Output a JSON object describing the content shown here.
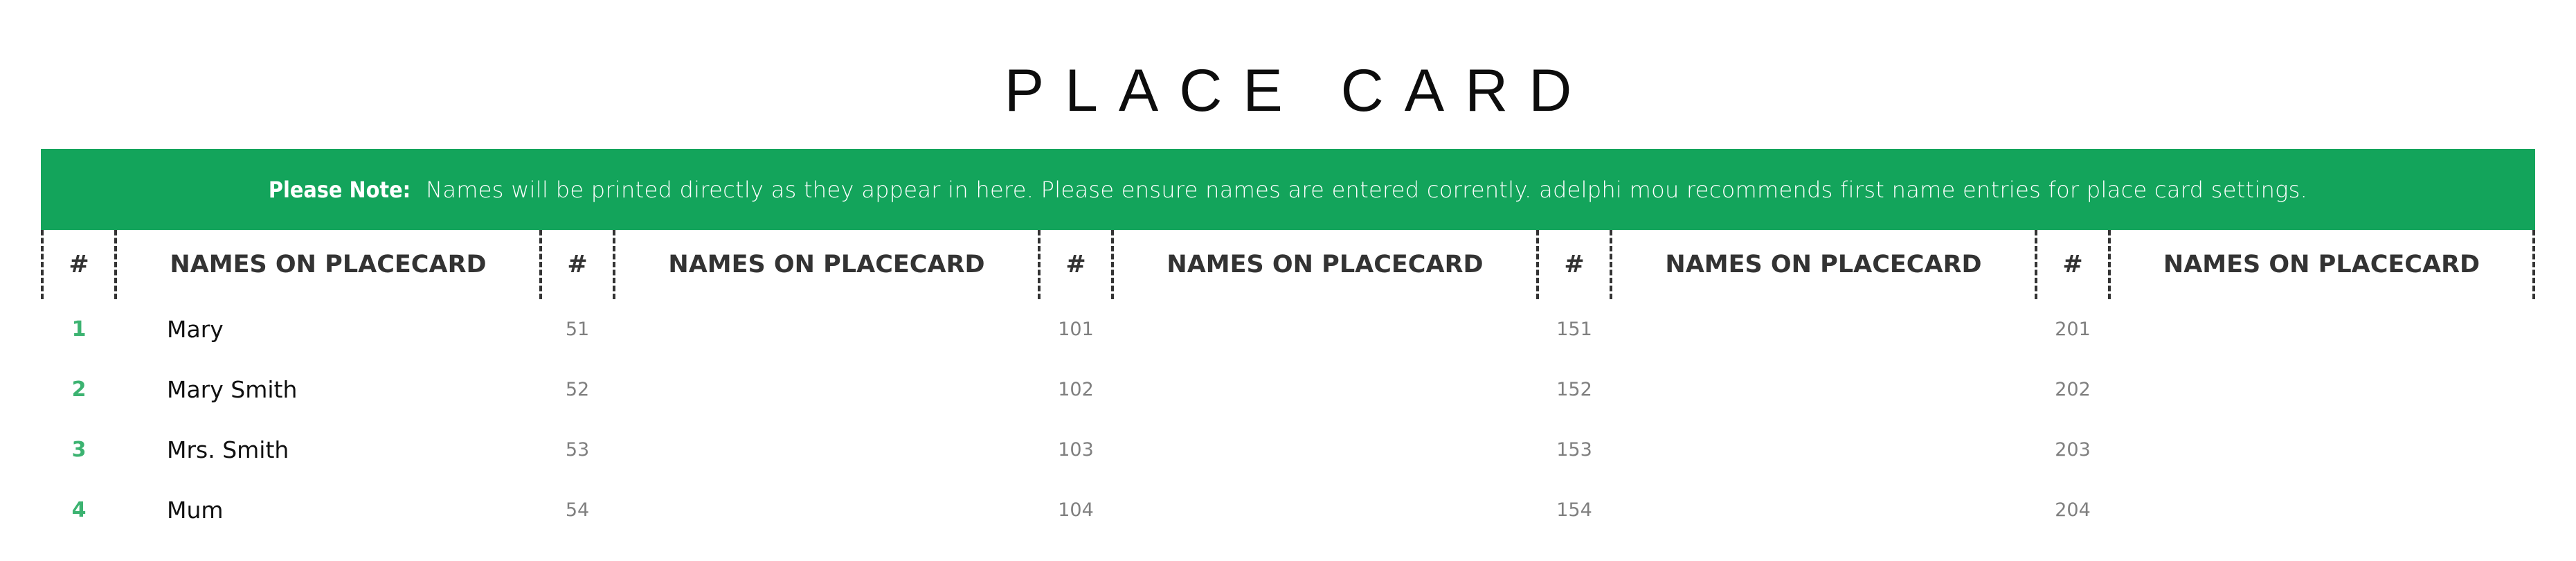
{
  "title": "PLACE CARD",
  "banner": {
    "label": "Please Note:",
    "text": "Names will be printed directly as they appear in here. Please ensure names are entered corrently. adelphi mou recommends first name entries for place card settings.",
    "color": "#13a45b"
  },
  "table": {
    "num_header": "#",
    "name_header": "NAMES ON PLACECARD",
    "groups": [
      {
        "rows": [
          {
            "num": "1",
            "name": "Mary"
          },
          {
            "num": "2",
            "name": "Mary Smith"
          },
          {
            "num": "3",
            "name": "Mrs. Smith"
          },
          {
            "num": "4",
            "name": "Mum"
          }
        ]
      },
      {
        "rows": [
          {
            "num": "51",
            "name": ""
          },
          {
            "num": "52",
            "name": ""
          },
          {
            "num": "53",
            "name": ""
          },
          {
            "num": "54",
            "name": ""
          }
        ]
      },
      {
        "rows": [
          {
            "num": "101",
            "name": ""
          },
          {
            "num": "102",
            "name": ""
          },
          {
            "num": "103",
            "name": ""
          },
          {
            "num": "104",
            "name": ""
          }
        ]
      },
      {
        "rows": [
          {
            "num": "151",
            "name": ""
          },
          {
            "num": "152",
            "name": ""
          },
          {
            "num": "153",
            "name": ""
          },
          {
            "num": "154",
            "name": ""
          }
        ]
      },
      {
        "rows": [
          {
            "num": "201",
            "name": ""
          },
          {
            "num": "202",
            "name": ""
          },
          {
            "num": "203",
            "name": ""
          },
          {
            "num": "204",
            "name": ""
          }
        ]
      }
    ]
  },
  "colors": {
    "accent_green": "#13a45b",
    "first_column_number": "#3cb371",
    "other_number": "#7f7f7f",
    "header_text": "#333333"
  }
}
